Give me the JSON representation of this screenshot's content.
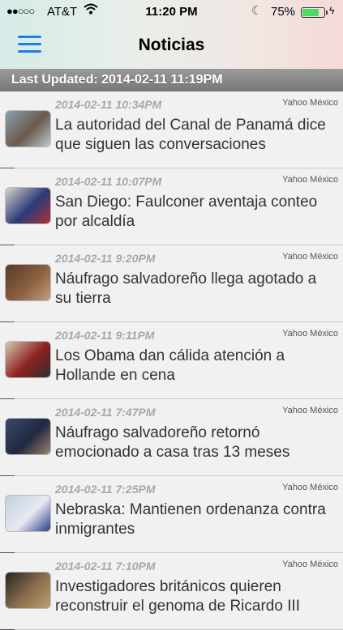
{
  "status_bar": {
    "signal": "●●○○○",
    "carrier": "AT&T",
    "time": "11:20 PM",
    "battery_pct": "75%",
    "battery_level": 0.75
  },
  "nav": {
    "title": "Noticias",
    "menu_icon": "hamburger-menu-icon"
  },
  "updated": {
    "text": "Last Updated: 2014-02-11 11:19PM"
  },
  "colors": {
    "accent": "#1a7fe6",
    "battery": "#4cd964"
  },
  "items": [
    {
      "date": "2014-02-11 10:34PM",
      "source": "Yahoo México",
      "title": "La autoridad del Canal de Panamá dice que siguen las conversaciones",
      "thumb_colors": [
        "#8aa0b0",
        "#6a5a4a",
        "#c0c8d0"
      ]
    },
    {
      "date": "2014-02-11 10:07PM",
      "source": "Yahoo México",
      "title": "San Diego: Faulconer aventaja conteo por alcaldía",
      "thumb_colors": [
        "#d8d4cc",
        "#2a3a7a",
        "#b03030"
      ]
    },
    {
      "date": "2014-02-11 9:20PM",
      "source": "Yahoo México",
      "title": "Náufrago salvadoreño llega agotado a su tierra",
      "thumb_colors": [
        "#5a3a2a",
        "#8a6040",
        "#c0a080"
      ]
    },
    {
      "date": "2014-02-11 9:11PM",
      "source": "Yahoo México",
      "title": "Los Obama dan cálida atención a Hollande en cena",
      "thumb_colors": [
        "#d8c8b0",
        "#8a2020",
        "#303030"
      ]
    },
    {
      "date": "2014-02-11 7:47PM",
      "source": "Yahoo México",
      "title": "Náufrago salvadoreño retornó emocionado a casa tras 13 meses",
      "thumb_colors": [
        "#3a4a6a",
        "#202840",
        "#a08070"
      ]
    },
    {
      "date": "2014-02-11 7:25PM",
      "source": "Yahoo México",
      "title": "Nebraska: Mantienen ordenanza contra inmigrantes",
      "thumb_colors": [
        "#c0d0e0",
        "#e8e8f0",
        "#2a3a8a"
      ]
    },
    {
      "date": "2014-02-11 7:10PM",
      "source": "Yahoo México",
      "title": "Investigadores británicos quieren reconstruir el genoma de Ricardo III",
      "thumb_colors": [
        "#2a2420",
        "#8a7050",
        "#c0a070"
      ]
    }
  ]
}
